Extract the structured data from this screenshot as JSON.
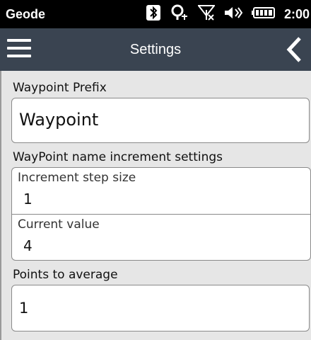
{
  "status_bar": {
    "app_name": "Geode",
    "time": "2:00",
    "icons": [
      "bluetooth-icon",
      "gps-icon",
      "no-signal-icon",
      "volume-icon",
      "battery-icon"
    ]
  },
  "app_bar": {
    "title": "Settings",
    "menu_icon": "hamburger-menu-icon",
    "back_icon": "back-chevron-icon"
  },
  "settings": {
    "waypoint_prefix": {
      "label": "Waypoint Prefix",
      "value": "Waypoint"
    },
    "increment_section": {
      "label": "WayPoint name increment settings",
      "step_size": {
        "label": "Increment step size",
        "value": "1"
      },
      "current_value": {
        "label": "Current value",
        "value": "4"
      }
    },
    "points_to_average": {
      "label": "Points to average",
      "value": "1"
    }
  },
  "colors": {
    "status_bar_bg": "#000000",
    "app_bar_bg": "#3a4451",
    "content_bg": "#e6e6e6"
  }
}
